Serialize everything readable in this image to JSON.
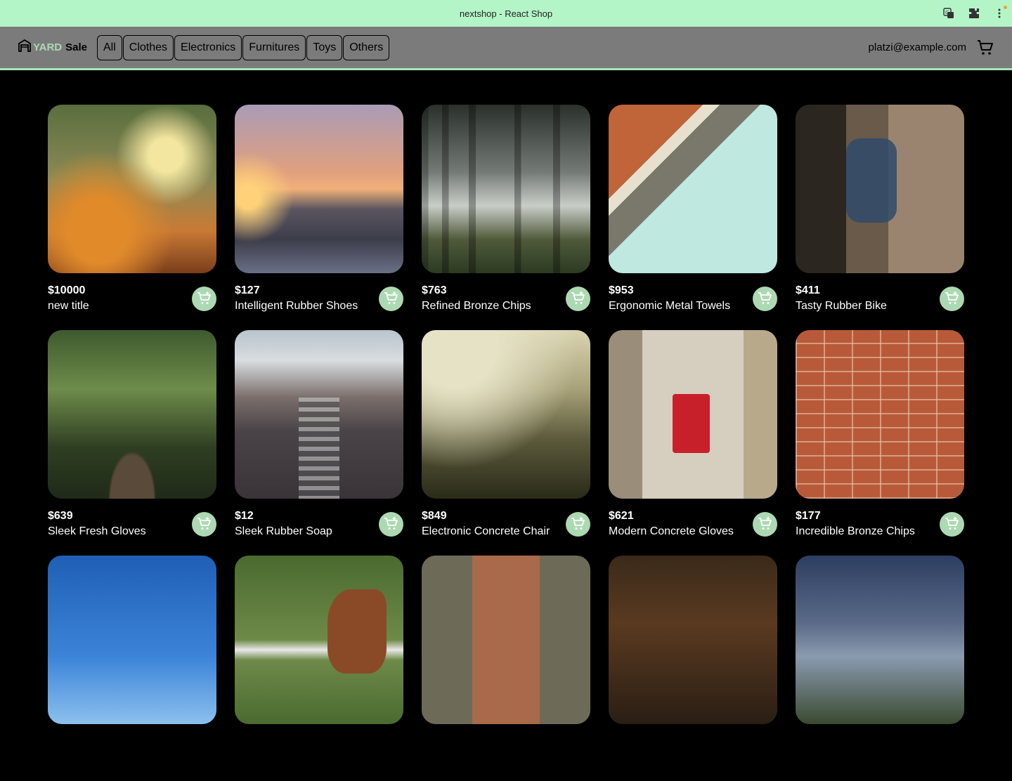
{
  "browser": {
    "title": "nextshop - React Shop",
    "icons": [
      "translate-icon",
      "extensions-icon",
      "more-menu-icon"
    ]
  },
  "navbar": {
    "logo_yard": "YARD",
    "logo_sale": "Sale",
    "categories": [
      "All",
      "Clothes",
      "Electronics",
      "Furnitures",
      "Toys",
      "Others"
    ],
    "email": "platzi@example.com"
  },
  "colors": {
    "titlebar": "#b4f5c8",
    "navbar": "#7b7b7b",
    "accent": "#acd9b2",
    "background": "#000000"
  },
  "products": [
    {
      "price": "$10000",
      "name": "new title",
      "image": "autumn-leaves"
    },
    {
      "price": "$127",
      "name": "Intelligent Rubber Shoes",
      "image": "sea-sunset"
    },
    {
      "price": "$763",
      "name": "Refined Bronze Chips",
      "image": "snowy-forest"
    },
    {
      "price": "$953",
      "name": "Ergonomic Metal Towels",
      "image": "stadium-arch"
    },
    {
      "price": "$411",
      "name": "Tasty Rubber Bike",
      "image": "person-sitting"
    },
    {
      "price": "$639",
      "name": "Sleek Fresh Gloves",
      "image": "forest-bridge"
    },
    {
      "price": "$12",
      "name": "Sleek Rubber Soap",
      "image": "city-traffic"
    },
    {
      "price": "$849",
      "name": "Electronic Concrete Chair",
      "image": "foggy-hill"
    },
    {
      "price": "$621",
      "name": "Modern Concrete Gloves",
      "image": "red-tram"
    },
    {
      "price": "$177",
      "name": "Incredible Bronze Chips",
      "image": "brick-wall"
    },
    {
      "price": "",
      "name": "",
      "image": "blue-sky"
    },
    {
      "price": "",
      "name": "",
      "image": "horse-fence"
    },
    {
      "price": "",
      "name": "",
      "image": "ravine"
    },
    {
      "price": "",
      "name": "",
      "image": "dark-woods"
    },
    {
      "price": "",
      "name": "",
      "image": "mountain"
    }
  ]
}
